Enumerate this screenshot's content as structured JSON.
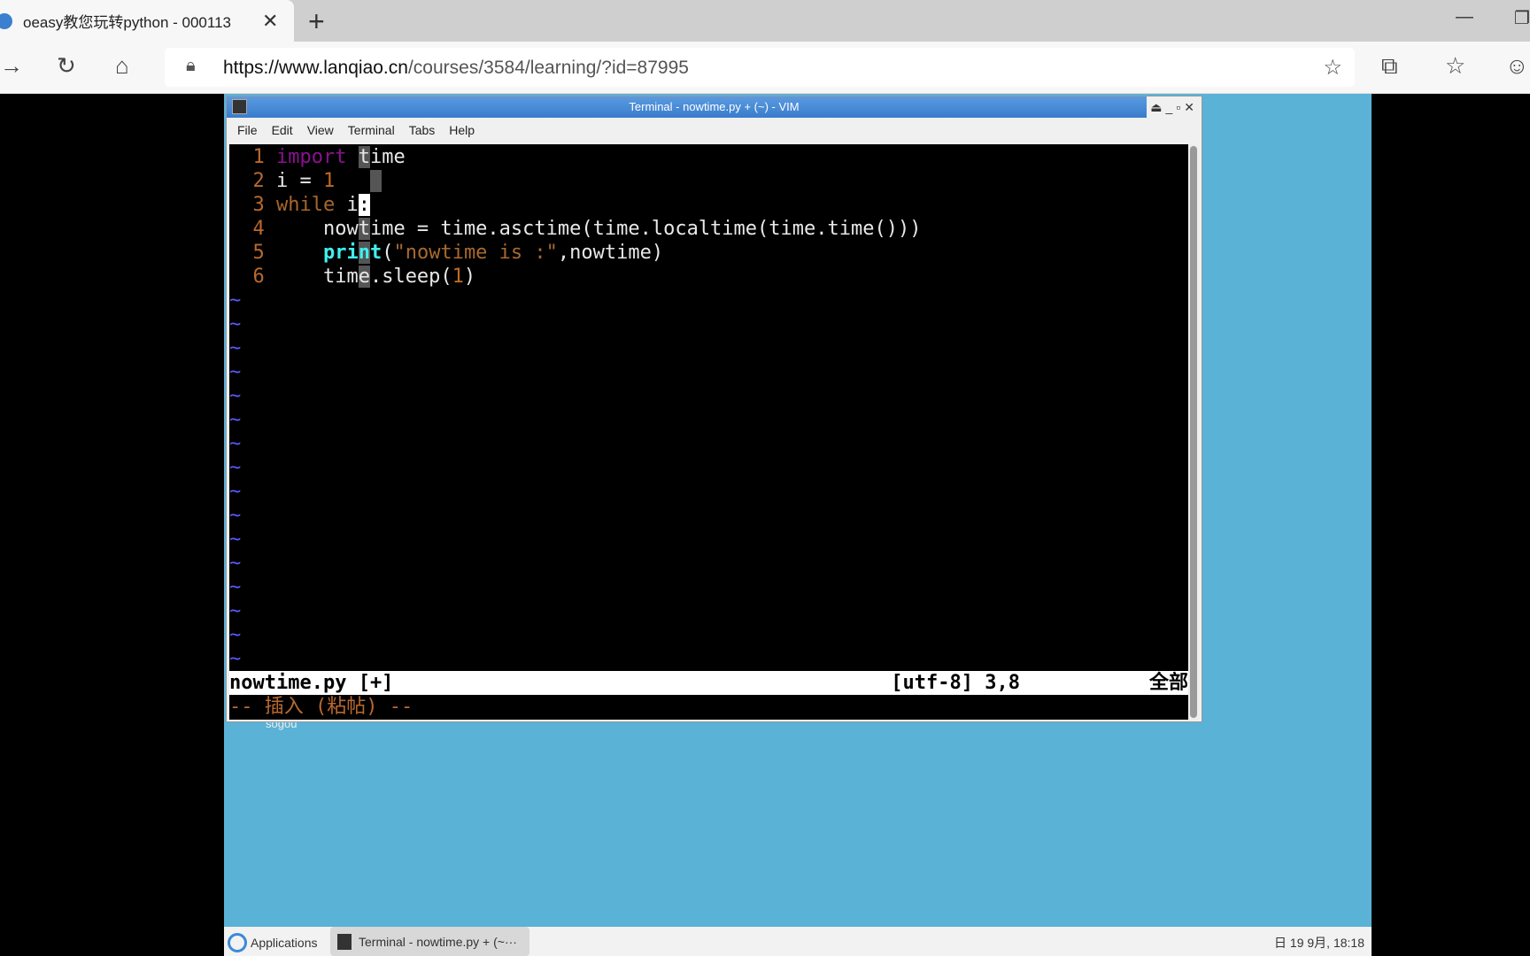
{
  "browser": {
    "tab_title": "oeasy教您玩转python - 000113",
    "url_host": "https://www.lanqiao.cn",
    "url_path": "/courses/3584/learning/?id=87995"
  },
  "terminal": {
    "title": "Terminal - nowtime.py + (~) - VIM",
    "menu": [
      "File",
      "Edit",
      "View",
      "Terminal",
      "Tabs",
      "Help"
    ],
    "status_left": "nowtime.py [+]",
    "status_pos": "[utf-8] 3,8",
    "status_right": "全部",
    "mode": "-- 插入 (粘帖) --"
  },
  "desktop": {
    "icon_label": "sogou"
  },
  "taskbar": {
    "apps": "Applications",
    "task": "Terminal - nowtime.py + (~···",
    "clock": "日 19 9月, 18:18"
  }
}
